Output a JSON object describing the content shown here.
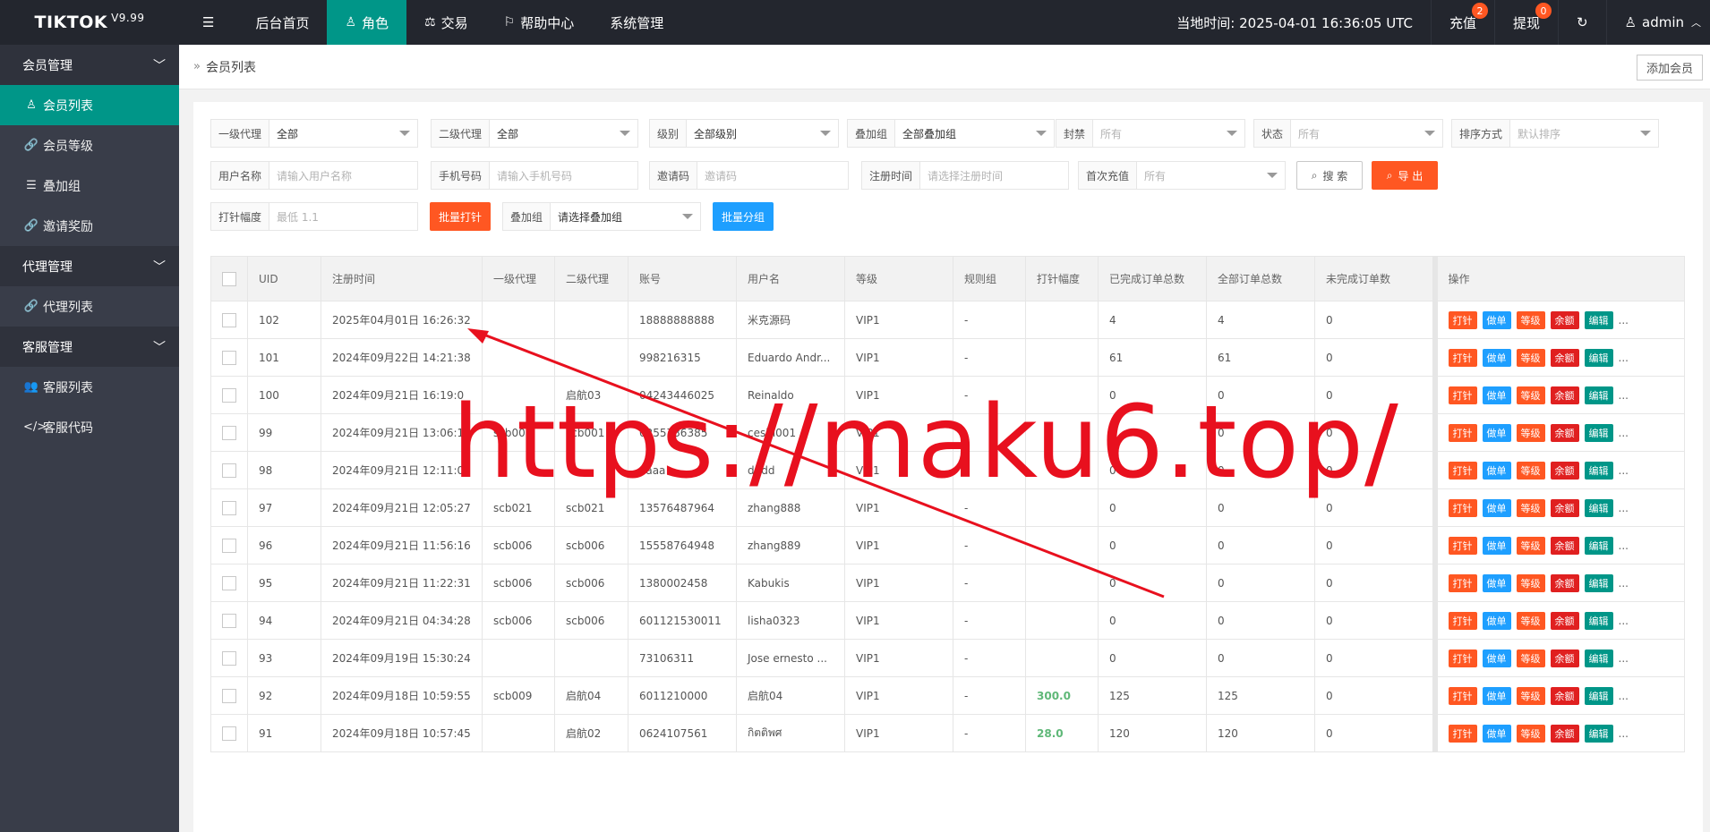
{
  "header": {
    "logo": "TIKTOK",
    "version": "V9.99",
    "nav": [
      {
        "label": "后台首页",
        "icon": ""
      },
      {
        "label": "角色",
        "icon": "user-icon"
      },
      {
        "label": "交易",
        "icon": "scale-icon"
      },
      {
        "label": "帮助中心",
        "icon": "flag-icon"
      },
      {
        "label": "系统管理",
        "icon": ""
      }
    ],
    "time": "当地时间: 2025-04-01 16:36:05  UTC",
    "recharge": "充值",
    "recharge_badge": "2",
    "withdraw": "提现",
    "withdraw_badge": "0",
    "user": "admin"
  },
  "sidebar": {
    "groups": [
      {
        "title": "会员管理",
        "items": [
          "会员列表",
          "会员等级",
          "叠加组",
          "邀请奖励"
        ]
      },
      {
        "title": "代理管理",
        "items": [
          "代理列表"
        ]
      },
      {
        "title": "客服管理",
        "items": [
          "客服列表",
          "客服代码"
        ]
      }
    ]
  },
  "crumb": "会员列表",
  "add_button": "添加会员",
  "filters": {
    "level1_agent": {
      "label": "一级代理",
      "value": "全部"
    },
    "level2_agent": {
      "label": "二级代理",
      "value": "全部"
    },
    "grade": {
      "label": "级别",
      "value": "全部级别"
    },
    "stack_group": {
      "label": "叠加组",
      "value": "全部叠加组"
    },
    "ban": {
      "label": "封禁",
      "value": "所有"
    },
    "status": {
      "label": "状态",
      "value": "所有"
    },
    "sort": {
      "label": "排序方式",
      "value": "默认排序"
    },
    "username": {
      "label": "用户名称",
      "placeholder": "请输入用户名称"
    },
    "phone": {
      "label": "手机号码",
      "placeholder": "请输入手机号码"
    },
    "invite": {
      "label": "邀请码",
      "placeholder": "邀请码"
    },
    "reg_time": {
      "label": "注册时间",
      "placeholder": "请选择注册时间"
    },
    "first_charge": {
      "label": "首次充值",
      "value": "所有"
    },
    "search": "搜 索",
    "export": "导 出",
    "pin_range": {
      "label": "打针幅度",
      "placeholder": "最低 1.1"
    },
    "batch_pin": "批量打针",
    "group2": {
      "label": "叠加组",
      "value": "请选择叠加组"
    },
    "batch_group": "批量分组"
  },
  "table": {
    "columns": [
      "UID",
      "注册时间",
      "一级代理",
      "二级代理",
      "账号",
      "用户名",
      "等级",
      "规则组",
      "打针幅度",
      "已完成订单总数",
      "全部订单总数",
      "未完成订单数",
      "操作"
    ],
    "rows": [
      [
        "102",
        "2025年04月01日 16:26:32",
        "",
        "",
        "18888888888",
        "米克源码",
        "VIP1",
        "-",
        "",
        "4",
        "4",
        "0"
      ],
      [
        "101",
        "2024年09月22日 14:21:38",
        "",
        "",
        "998216315",
        "Eduardo Andr...",
        "VIP1",
        "-",
        "",
        "61",
        "61",
        "0"
      ],
      [
        "100",
        "2024年09月21日 16:19:0",
        "",
        "启航03",
        "04243446025",
        "Reinaldo",
        "VIP1",
        "-",
        "",
        "0",
        "0",
        "0"
      ],
      [
        "99",
        "2024年09月21日 13:06:1",
        "scb001",
        "scb001",
        "0255786385",
        "ceshi001",
        "VIP1",
        "-",
        "",
        "0",
        "0",
        "0"
      ],
      [
        "98",
        "2024年09月21日 12:11:08",
        "",
        "",
        "aaaa",
        "dddd",
        "VIP1",
        "-",
        "",
        "0",
        "0",
        "0"
      ],
      [
        "97",
        "2024年09月21日 12:05:27",
        "scb021",
        "scb021",
        "13576487964",
        "zhang888",
        "VIP1",
        "-",
        "",
        "0",
        "0",
        "0"
      ],
      [
        "96",
        "2024年09月21日 11:56:16",
        "scb006",
        "scb006",
        "15558764948",
        "zhang889",
        "VIP1",
        "-",
        "",
        "0",
        "0",
        "0"
      ],
      [
        "95",
        "2024年09月21日 11:22:31",
        "scb006",
        "scb006",
        "1380002458",
        "Kabukis",
        "VIP1",
        "-",
        "",
        "0",
        "0",
        "0"
      ],
      [
        "94",
        "2024年09月21日 04:34:28",
        "scb006",
        "scb006",
        "601121530011",
        "lisha0323",
        "VIP1",
        "-",
        "",
        "0",
        "0",
        "0"
      ],
      [
        "93",
        "2024年09月19日 15:30:24",
        "",
        "",
        "73106311",
        "Jose ernesto ...",
        "VIP1",
        "-",
        "",
        "0",
        "0",
        "0"
      ],
      [
        "92",
        "2024年09月18日 10:59:55",
        "scb009",
        "启航04",
        "6011210000",
        "启航04",
        "VIP1",
        "-",
        "300.0",
        "125",
        "125",
        "0"
      ],
      [
        "91",
        "2024年09月18日 10:57:45",
        "",
        "启航02",
        "0624107561",
        "กิตติพศ",
        "VIP1",
        "-",
        "28.0",
        "120",
        "120",
        "0"
      ]
    ],
    "actions": [
      "打针",
      "做单",
      "等级",
      "余额",
      "编辑"
    ],
    "more": "..."
  },
  "overlay": {
    "watermark": "https://maku6.top/"
  }
}
